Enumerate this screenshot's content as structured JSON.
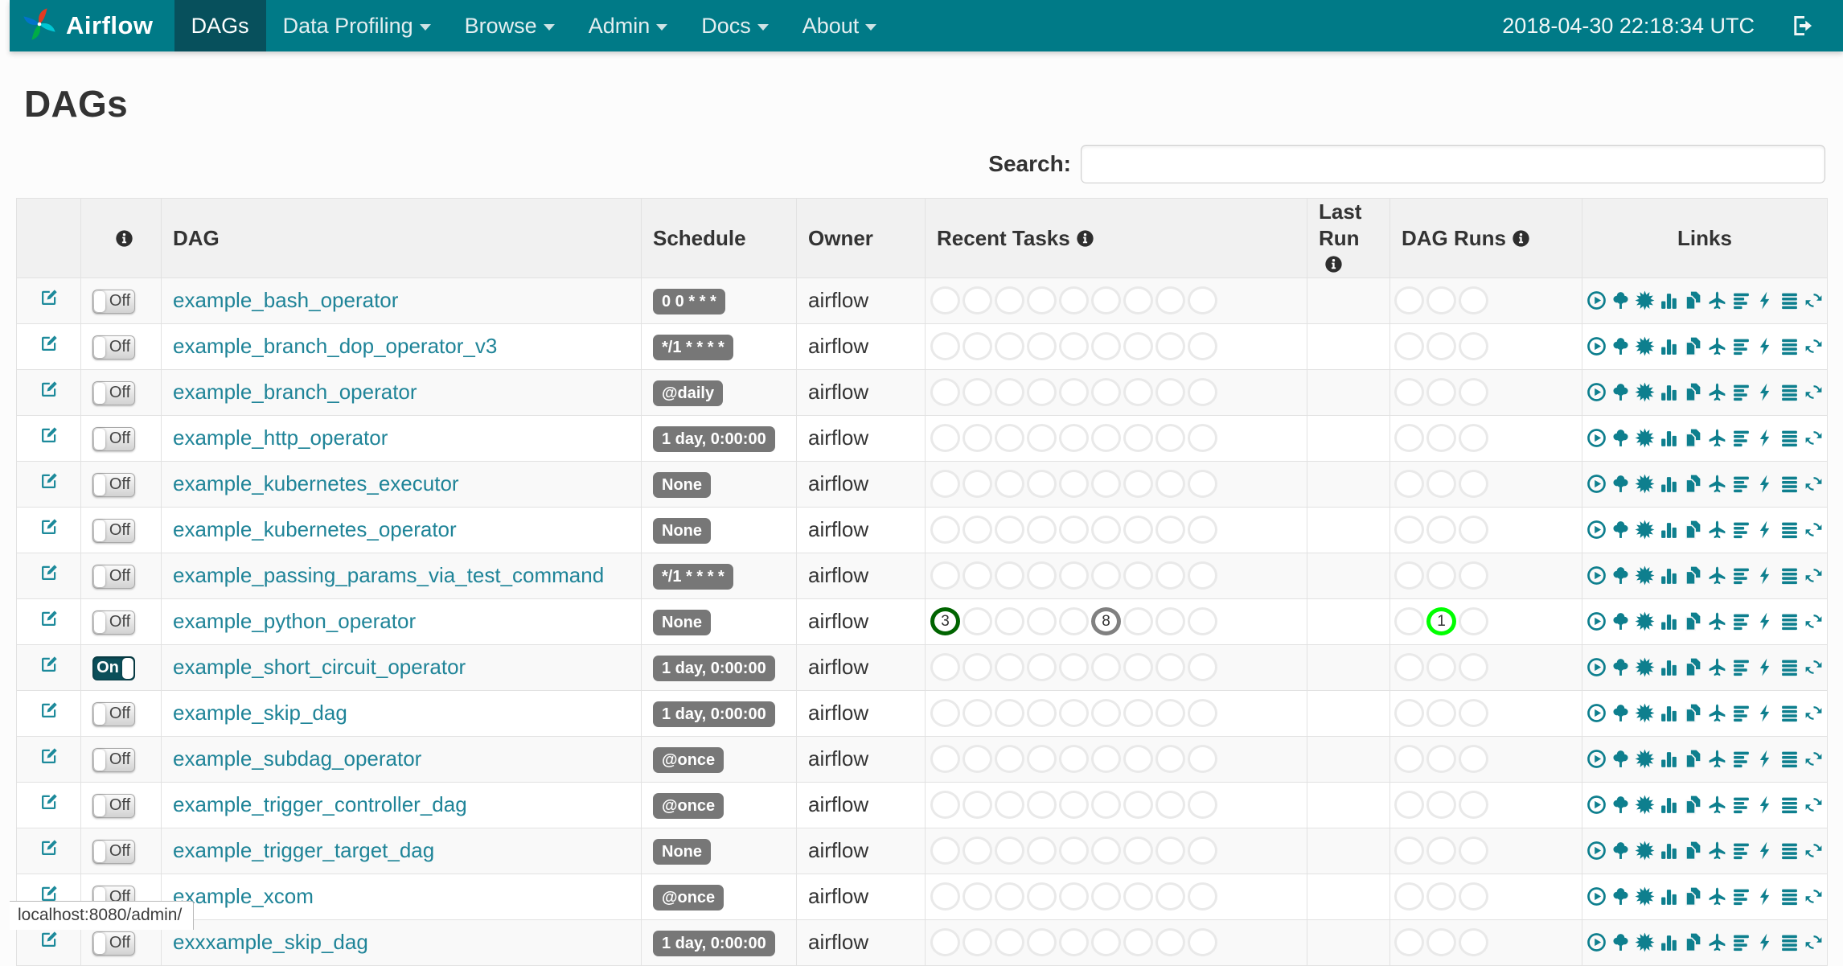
{
  "colors": {
    "navbar": "#007A87",
    "navbar_active": "#07505C",
    "link_teal": "#1F8498",
    "icon_teal": "#0E7F8E",
    "badge_gray": "#777777",
    "state_colors": {
      "success": "#006400",
      "running": "#00FF00",
      "queued": "#808080"
    },
    "empty_circle": "#E9E9E9"
  },
  "navbar": {
    "brand": "Airflow",
    "items": [
      {
        "label": "DAGs",
        "active": true,
        "dropdown": false
      },
      {
        "label": "Data Profiling",
        "active": false,
        "dropdown": true
      },
      {
        "label": "Browse",
        "active": false,
        "dropdown": true
      },
      {
        "label": "Admin",
        "active": false,
        "dropdown": true
      },
      {
        "label": "Docs",
        "active": false,
        "dropdown": true
      },
      {
        "label": "About",
        "active": false,
        "dropdown": true
      }
    ],
    "datetime": "2018-04-30 22:18:34 UTC",
    "logout_icon": "sign-out-icon"
  },
  "page": {
    "title": "DAGs",
    "search_label": "Search:",
    "search_value": "",
    "status_bar": "localhost:8080/admin/"
  },
  "table": {
    "headers": {
      "edit": "",
      "info_icon": "info-icon",
      "dag": "DAG",
      "schedule": "Schedule",
      "owner": "Owner",
      "recent_tasks": "Recent Tasks",
      "last_run": "Last Run",
      "dag_runs": "DAG Runs",
      "links": "Links"
    },
    "recent_task_slots": 9,
    "dag_run_slots": 3,
    "links_icons": [
      "play-circle-icon",
      "tree-icon",
      "sunburst-icon",
      "bar-chart-icon",
      "copy-pages-icon",
      "plane-icon",
      "gantt-bars-icon",
      "bolt-icon",
      "justify-lines-icon",
      "refresh-icon"
    ],
    "rows": [
      {
        "name": "example_bash_operator",
        "toggle": "Off",
        "schedule": "0 0 * * *",
        "owner": "airflow",
        "last_run": "",
        "recent_tasks": [],
        "dag_runs": []
      },
      {
        "name": "example_branch_dop_operator_v3",
        "toggle": "Off",
        "schedule": "*/1 * * * *",
        "owner": "airflow",
        "last_run": "",
        "recent_tasks": [],
        "dag_runs": []
      },
      {
        "name": "example_branch_operator",
        "toggle": "Off",
        "schedule": "@daily",
        "owner": "airflow",
        "last_run": "",
        "recent_tasks": [],
        "dag_runs": []
      },
      {
        "name": "example_http_operator",
        "toggle": "Off",
        "schedule": "1 day, 0:00:00",
        "owner": "airflow",
        "last_run": "",
        "recent_tasks": [],
        "dag_runs": []
      },
      {
        "name": "example_kubernetes_executor",
        "toggle": "Off",
        "schedule": "None",
        "owner": "airflow",
        "last_run": "",
        "recent_tasks": [],
        "dag_runs": []
      },
      {
        "name": "example_kubernetes_operator",
        "toggle": "Off",
        "schedule": "None",
        "owner": "airflow",
        "last_run": "",
        "recent_tasks": [],
        "dag_runs": []
      },
      {
        "name": "example_passing_params_via_test_command",
        "toggle": "Off",
        "schedule": "*/1 * * * *",
        "owner": "airflow",
        "last_run": "",
        "recent_tasks": [],
        "dag_runs": []
      },
      {
        "name": "example_python_operator",
        "toggle": "Off",
        "schedule": "None",
        "owner": "airflow",
        "last_run": "",
        "recent_tasks": [
          {
            "index": 0,
            "count": "3",
            "state": "success"
          },
          {
            "index": 5,
            "count": "8",
            "state": "queued"
          }
        ],
        "dag_runs": [
          {
            "index": 1,
            "count": "1",
            "state": "running"
          }
        ]
      },
      {
        "name": "example_short_circuit_operator",
        "toggle": "On",
        "schedule": "1 day, 0:00:00",
        "owner": "airflow",
        "last_run": "",
        "recent_tasks": [],
        "dag_runs": []
      },
      {
        "name": "example_skip_dag",
        "toggle": "Off",
        "schedule": "1 day, 0:00:00",
        "owner": "airflow",
        "last_run": "",
        "recent_tasks": [],
        "dag_runs": []
      },
      {
        "name": "example_subdag_operator",
        "toggle": "Off",
        "schedule": "@once",
        "owner": "airflow",
        "last_run": "",
        "recent_tasks": [],
        "dag_runs": []
      },
      {
        "name": "example_trigger_controller_dag",
        "toggle": "Off",
        "schedule": "@once",
        "owner": "airflow",
        "last_run": "",
        "recent_tasks": [],
        "dag_runs": []
      },
      {
        "name": "example_trigger_target_dag",
        "toggle": "Off",
        "schedule": "None",
        "owner": "airflow",
        "last_run": "",
        "recent_tasks": [],
        "dag_runs": []
      },
      {
        "name": "example_xcom",
        "toggle": "Off",
        "schedule": "@once",
        "owner": "airflow",
        "last_run": "",
        "recent_tasks": [],
        "dag_runs": []
      },
      {
        "name": "exxxample_skip_dag",
        "toggle": "Off",
        "schedule": "1 day, 0:00:00",
        "owner": "airflow",
        "last_run": "",
        "recent_tasks": [],
        "dag_runs": []
      }
    ]
  }
}
